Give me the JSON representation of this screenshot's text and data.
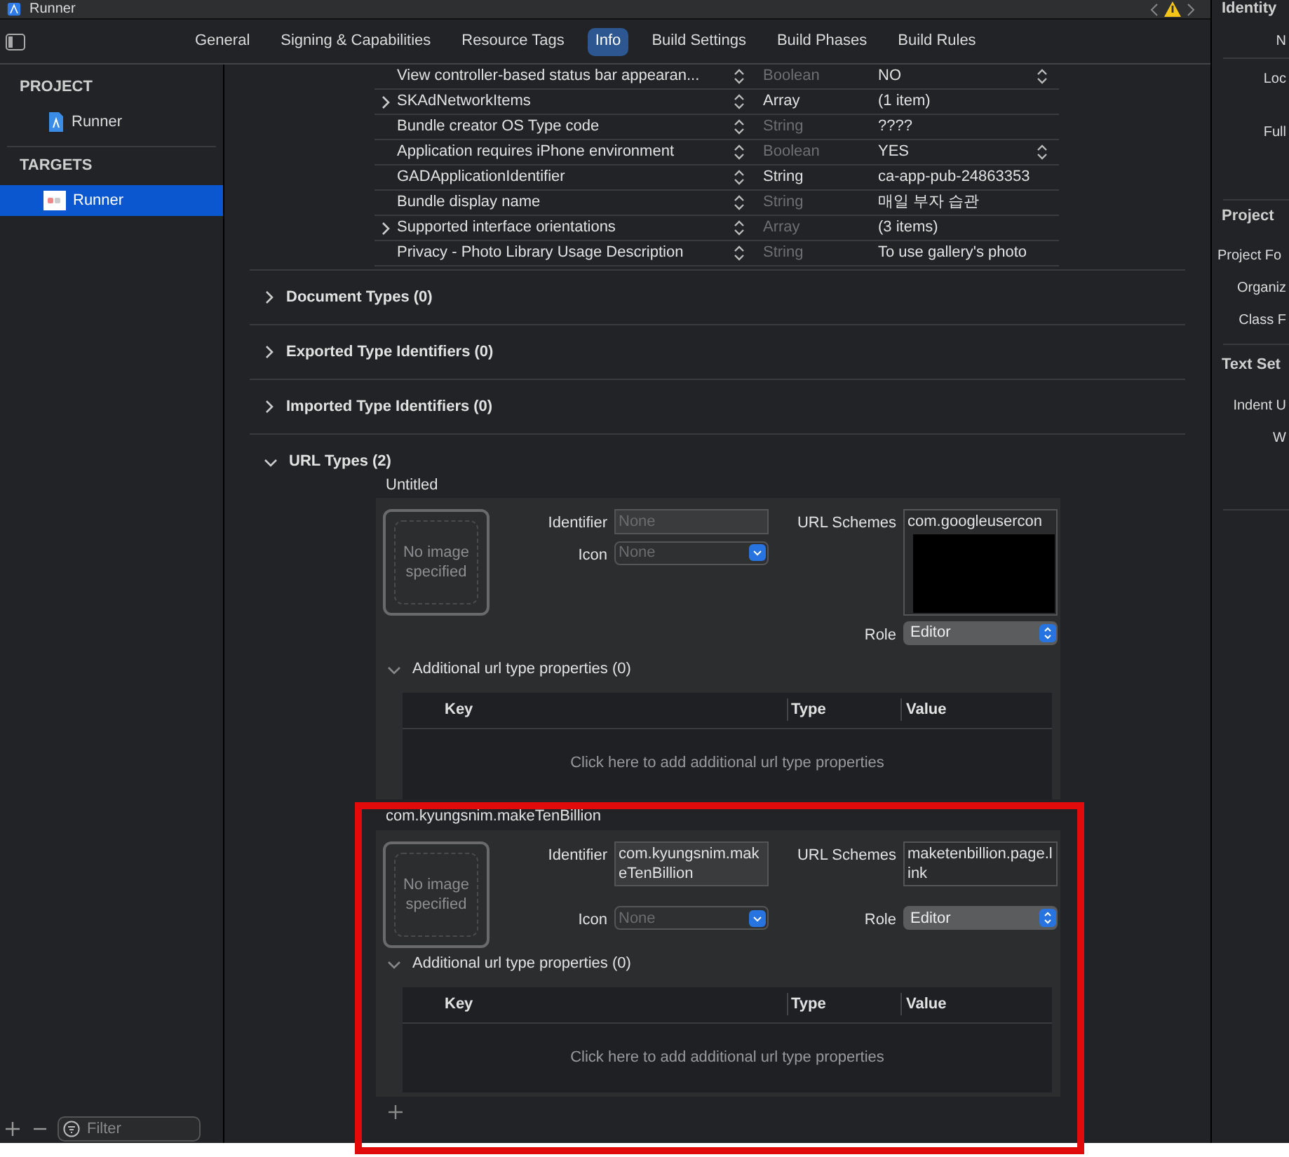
{
  "window": {
    "title": "Runner"
  },
  "tabs": [
    {
      "label": "General",
      "selected": false
    },
    {
      "label": "Signing & Capabilities",
      "selected": false
    },
    {
      "label": "Resource Tags",
      "selected": false
    },
    {
      "label": "Info",
      "selected": true
    },
    {
      "label": "Build Settings",
      "selected": false
    },
    {
      "label": "Build Phases",
      "selected": false
    },
    {
      "label": "Build Rules",
      "selected": false
    }
  ],
  "sidebar": {
    "sections": [
      {
        "heading": "PROJECT",
        "items": [
          {
            "label": "Runner",
            "kind": "project",
            "selected": false
          }
        ]
      },
      {
        "heading": "TARGETS",
        "items": [
          {
            "label": "Runner",
            "kind": "target",
            "selected": true
          }
        ]
      }
    ],
    "filter": {
      "placeholder": "Filter"
    }
  },
  "info_properties": [
    {
      "key": "View controller-based status bar appearan...",
      "expandable": false,
      "type": "Boolean",
      "type_dim": true,
      "value": "NO",
      "value_popup": true
    },
    {
      "key": "SKAdNetworkItems",
      "expandable": true,
      "type": "Array",
      "type_dim": false,
      "value": "(1 item)",
      "value_popup": false
    },
    {
      "key": "Bundle creator OS Type code",
      "expandable": false,
      "type": "String",
      "type_dim": true,
      "value": "????",
      "value_popup": false
    },
    {
      "key": "Application requires iPhone environment",
      "expandable": false,
      "type": "Boolean",
      "type_dim": true,
      "value": "YES",
      "value_popup": true
    },
    {
      "key": "GADApplicationIdentifier",
      "expandable": false,
      "type": "String",
      "type_dim": false,
      "value": "ca-app-pub-24863353",
      "value_popup": false
    },
    {
      "key": "Bundle display name",
      "expandable": false,
      "type": "String",
      "type_dim": true,
      "value": "매일 부자 습관",
      "value_popup": false
    },
    {
      "key": "Supported interface orientations",
      "expandable": true,
      "type": "Array",
      "type_dim": true,
      "value": "(3 items)",
      "value_popup": false
    },
    {
      "key": "Privacy - Photo Library Usage Description",
      "expandable": false,
      "type": "String",
      "type_dim": true,
      "value": "To use gallery's photo",
      "value_popup": false
    }
  ],
  "sections": [
    {
      "title": "Document Types (0)",
      "expanded": false
    },
    {
      "title": "Exported Type Identifiers (0)",
      "expanded": false
    },
    {
      "title": "Imported Type Identifiers (0)",
      "expanded": false
    },
    {
      "title": "URL Types (2)",
      "expanded": true
    }
  ],
  "url_types": [
    {
      "name": "Untitled",
      "image_text": "No image specified",
      "identifier_label": "Identifier",
      "identifier": {
        "placeholder": "None"
      },
      "icon_label": "Icon",
      "icon": {
        "placeholder": "None"
      },
      "schemes_label": "URL Schemes",
      "url_schemes": [
        "com.googleusercon"
      ],
      "redacted": true,
      "role_label": "Role",
      "role": "Editor",
      "additional": {
        "title": "Additional url type properties (0)",
        "expanded": true,
        "columns": [
          "Key",
          "Type",
          "Value"
        ],
        "empty_hint": "Click here to add additional url type properties"
      },
      "highlighted": false
    },
    {
      "name": "com.kyungsnim.makeTenBillion",
      "image_text": "No image specified",
      "identifier_label": "Identifier",
      "identifier": {
        "value": "com.kyungsnim.makeTenBillion"
      },
      "icon_label": "Icon",
      "icon": {
        "placeholder": "None"
      },
      "schemes_label": "URL Schemes",
      "url_schemes": [
        "maketenbillion.page.link"
      ],
      "redacted": false,
      "role_label": "Role",
      "role": "Editor",
      "additional": {
        "title": "Additional url type properties (0)",
        "expanded": true,
        "columns": [
          "Key",
          "Type",
          "Value"
        ],
        "empty_hint": "Click here to add additional url type properties"
      },
      "highlighted": true
    }
  ],
  "inspector": {
    "groups": [
      {
        "heading": "Identity",
        "labels": [
          "N",
          "Loc",
          "Full"
        ]
      },
      {
        "heading": "Project",
        "labels": [
          "Project Fo",
          "Organiz",
          "Class F"
        ]
      },
      {
        "heading": "Text Set",
        "labels": [
          "Indent U",
          "W"
        ]
      }
    ]
  }
}
